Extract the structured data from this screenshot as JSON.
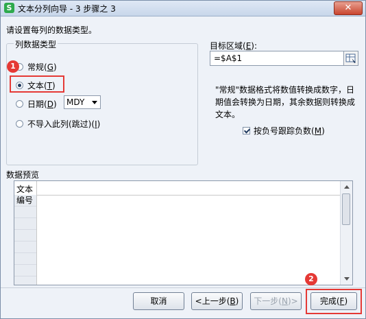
{
  "window": {
    "title": "文本分列向导 - 3 步骤之 3",
    "app_icon_letter": "S",
    "close_symbol": "✕"
  },
  "instruction": "请设置每列的数据类型。",
  "column_type_group": {
    "legend": "列数据类型",
    "options": [
      {
        "label": "常规",
        "key": "G",
        "checked": false
      },
      {
        "label": "文本",
        "key": "T",
        "checked": true
      },
      {
        "label": "日期",
        "key": "D",
        "checked": false
      },
      {
        "label": "不导入此列(跳过)",
        "key": "I",
        "checked": false
      }
    ],
    "date_format": "MDY"
  },
  "destination": {
    "label": "目标区域",
    "key": "E",
    "value": "=$A$1"
  },
  "description": "\"常规\"数据格式将数值转换成数字，日期值会转换为日期，其余数据则转换成文本。",
  "negative_checkbox": {
    "label": "按负号跟踪负数",
    "key": "M",
    "checked": true
  },
  "preview": {
    "label": "数据预览",
    "header": "文本",
    "rows": [
      "编号"
    ]
  },
  "annotations": {
    "badge1": "1",
    "badge2": "2",
    "highlight_color": "#e53935"
  },
  "buttons": {
    "cancel": "取消",
    "back_prefix": "<上一步(",
    "back_key": "B",
    "next_prefix": "下一步(",
    "next_key": "N",
    "next_suffix": ")>",
    "finish_prefix": "完成(",
    "finish_key": "F"
  }
}
